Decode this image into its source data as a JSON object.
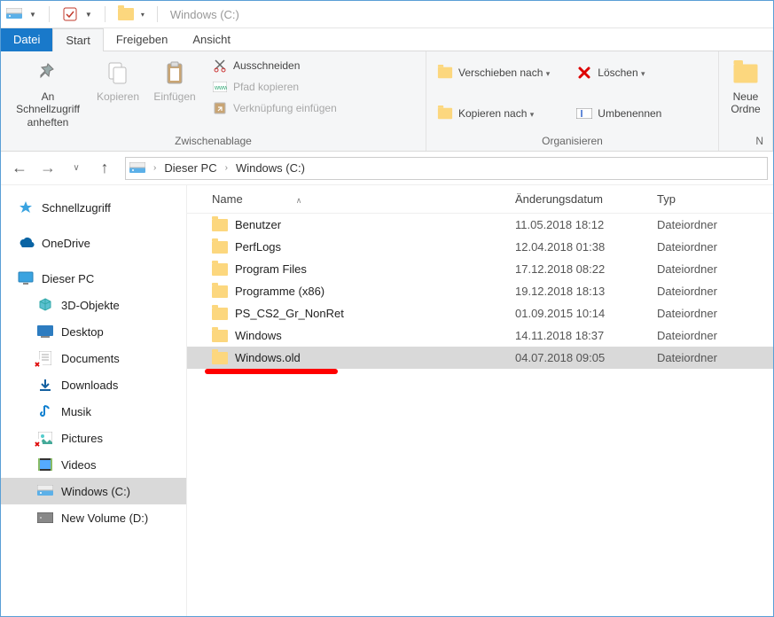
{
  "titlebar": {
    "title": "Windows (C:)"
  },
  "tabs": {
    "file": "Datei",
    "start": "Start",
    "share": "Freigeben",
    "view": "Ansicht"
  },
  "ribbon": {
    "clipboard": {
      "pin": "An Schnellzugriff\nanheften",
      "copy": "Kopieren",
      "paste": "Einfügen",
      "cut": "Ausschneiden",
      "copypath": "Pfad kopieren",
      "pasteshortcut": "Verknüpfung einfügen",
      "label": "Zwischenablage"
    },
    "organize": {
      "moveto": "Verschieben nach",
      "copyto": "Kopieren nach",
      "delete": "Löschen",
      "rename": "Umbenennen",
      "label": "Organisieren"
    },
    "new": {
      "newfolder": "Neue\nOrdne",
      "label": "N"
    }
  },
  "breadcrumb": {
    "root": "Dieser PC",
    "loc": "Windows (C:)"
  },
  "columns": {
    "name": "Name",
    "date": "Änderungsdatum",
    "type": "Typ"
  },
  "sidebar": {
    "quick": "Schnellzugriff",
    "onedrive": "OneDrive",
    "thispc": "Dieser PC",
    "objects3d": "3D-Objekte",
    "desktop": "Desktop",
    "documents": "Documents",
    "downloads": "Downloads",
    "music": "Musik",
    "pictures": "Pictures",
    "videos": "Videos",
    "cdrive": "Windows (C:)",
    "ddrive": "New Volume (D:)"
  },
  "files": [
    {
      "name": "Benutzer",
      "date": "11.05.2018 18:12",
      "type": "Dateiordner"
    },
    {
      "name": "PerfLogs",
      "date": "12.04.2018 01:38",
      "type": "Dateiordner"
    },
    {
      "name": "Program Files",
      "date": "17.12.2018 08:22",
      "type": "Dateiordner"
    },
    {
      "name": "Programme (x86)",
      "date": "19.12.2018 18:13",
      "type": "Dateiordner"
    },
    {
      "name": "PS_CS2_Gr_NonRet",
      "date": "01.09.2015 10:14",
      "type": "Dateiordner"
    },
    {
      "name": "Windows",
      "date": "14.11.2018 18:37",
      "type": "Dateiordner"
    },
    {
      "name": "Windows.old",
      "date": "04.07.2018 09:05",
      "type": "Dateiordner"
    }
  ],
  "selected_row": 6
}
